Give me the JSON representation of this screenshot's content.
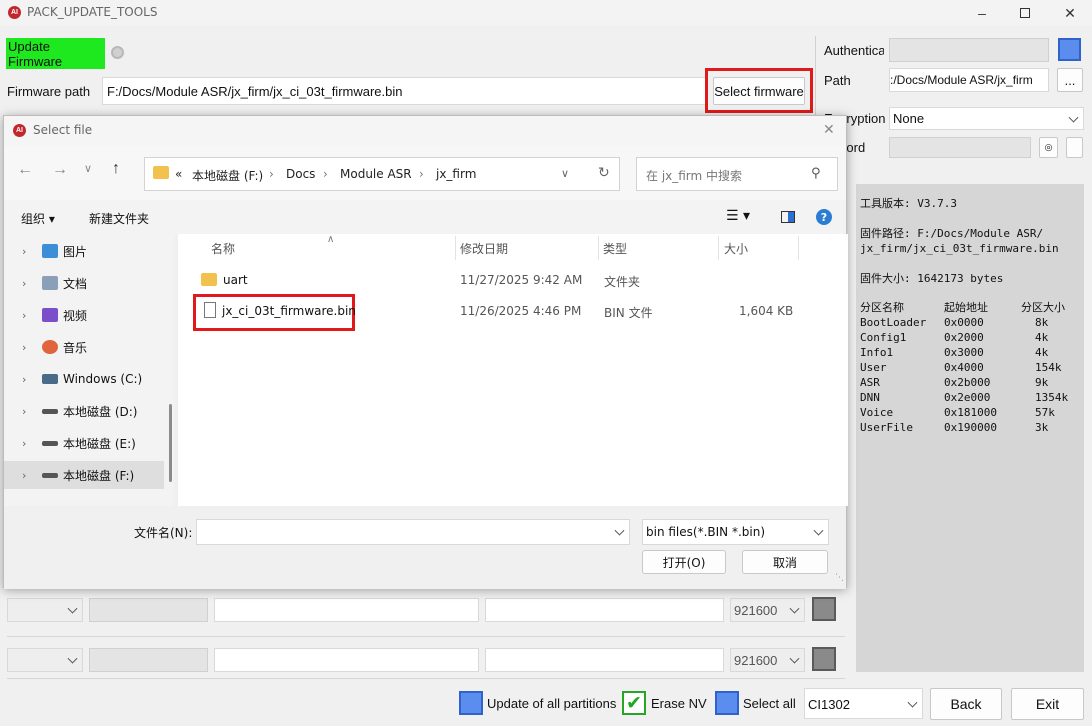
{
  "window": {
    "title": "PACK_UPDATE_TOOLS",
    "logo_text": "AI"
  },
  "main": {
    "update_firmware_label": "Update Firmware",
    "firmware_path_label": "Firmware path",
    "firmware_path_value": "F:/Docs/Module ASR/jx_firm/jx_ci_03t_firmware.bin",
    "select_firmware_label": "Select firmware",
    "accent_green": "#1ee81e",
    "highlight_red": "#e01a1a"
  },
  "right_panel": {
    "authentication_label": "Authentica",
    "path_label": "Path",
    "path_value": ":/Docs/Module ASR/jx_firm",
    "browse_label": "...",
    "encryption_label": "Encryption",
    "encryption_value": "None",
    "password_label": "ssword"
  },
  "log": {
    "tool_version": "工具版本: V3.7.3",
    "fw_path_line1": "固件路径: F:/Docs/Module ASR/",
    "fw_path_line2": "jx_firm/jx_ci_03t_firmware.bin",
    "fw_size": "固件大小: 1642173 bytes",
    "headers": [
      "分区名称",
      "起始地址",
      "分区大小"
    ],
    "partitions": [
      [
        "BootLoader",
        "0x0000",
        "8k"
      ],
      [
        "Config1",
        "0x2000",
        "4k"
      ],
      [
        "Info1",
        "0x3000",
        "4k"
      ],
      [
        "User",
        "0x4000",
        "154k"
      ],
      [
        "ASR",
        "0x2b000",
        "9k"
      ],
      [
        "DNN",
        "0x2e000",
        "1354k"
      ],
      [
        "Voice",
        "0x181000",
        "57k"
      ],
      [
        "UserFile",
        "0x190000",
        "3k"
      ]
    ]
  },
  "ports": {
    "baud1": "921600",
    "baud2": "921600"
  },
  "footer": {
    "update_all_label": "Update of all partitions",
    "erase_nv_label": "Erase NV",
    "select_all_label": "Select all",
    "chip_value": "CI1302",
    "back_label": "Back",
    "exit_label": "Exit"
  },
  "dialog": {
    "title": "Select file",
    "breadcrumb": [
      "本地磁盘 (F:)",
      "Docs",
      "Module ASR",
      "jx_firm"
    ],
    "search_placeholder": "在 jx_firm 中搜索",
    "organize_label": "组织 ▾",
    "new_folder_label": "新建文件夹",
    "nav_items": [
      {
        "label": "图片",
        "color": "#3c8fd6"
      },
      {
        "label": "文档",
        "color": "#8aa0b8"
      },
      {
        "label": "视频",
        "color": "#7b4fc9"
      },
      {
        "label": "音乐",
        "color": "#e0643c"
      },
      {
        "label": "Windows (C:)",
        "color": "#4a6a8a"
      },
      {
        "label": "本地磁盘 (D:)",
        "color": "#555555"
      },
      {
        "label": "本地磁盘 (E:)",
        "color": "#555555"
      },
      {
        "label": "本地磁盘 (F:)",
        "color": "#555555"
      }
    ],
    "columns": {
      "name": "名称",
      "modified": "修改日期",
      "type": "类型",
      "size": "大小"
    },
    "files": [
      {
        "name": "uart",
        "modified": "11/27/2025 9:42 AM",
        "type": "文件夹",
        "size": ""
      },
      {
        "name": "jx_ci_03t_firmware.bin",
        "modified": "11/26/2025 4:46 PM",
        "type": "BIN 文件",
        "size": "1,604 KB"
      }
    ],
    "filename_label": "文件名(N):",
    "filename_value": "",
    "filter_value": "bin files(*.BIN *.bin)",
    "open_label": "打开(O)",
    "cancel_label": "取消"
  }
}
